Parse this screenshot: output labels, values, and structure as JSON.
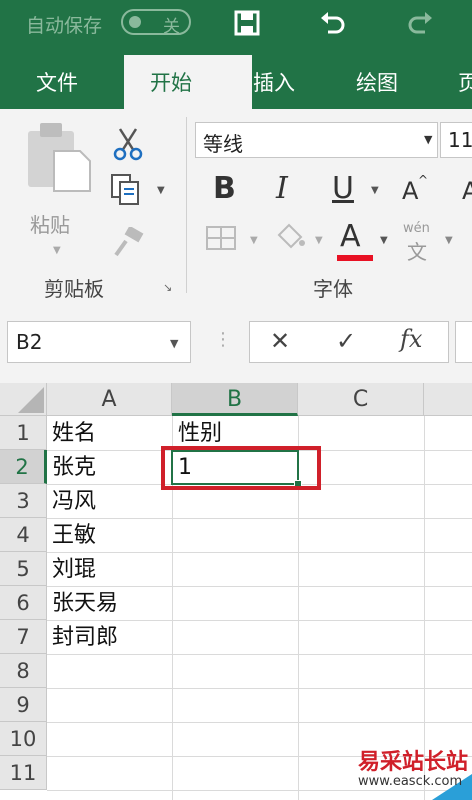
{
  "titlebar": {
    "autosave_label": "自动保存",
    "autosave_state": "关"
  },
  "tabs": [
    {
      "label": "文件"
    },
    {
      "label": "开始"
    },
    {
      "label": "插入"
    },
    {
      "label": "绘图"
    },
    {
      "label": "页"
    }
  ],
  "ribbon": {
    "paste_label": "粘贴",
    "clipboard_group": "剪贴板",
    "font_group": "字体",
    "font_name": "等线",
    "font_size": "11",
    "bold": "B",
    "italic": "I",
    "underline": "U",
    "grow_font": "A",
    "font_color": "A",
    "phonetic_top": "wén",
    "phonetic_bottom": "文",
    "font_color_hex": "#e81123"
  },
  "formula_bar": {
    "name_box": "B2",
    "cancel": "✕",
    "enter": "✓",
    "fx": "fx"
  },
  "sheet": {
    "columns": [
      "A",
      "B",
      "C"
    ],
    "rows": [
      "1",
      "2",
      "3",
      "4",
      "5",
      "6",
      "7",
      "8",
      "9",
      "10",
      "11"
    ],
    "cells": {
      "A1": "姓名",
      "B1": "性别",
      "A2": "张克",
      "B2": "1",
      "A3": "冯风",
      "A4": "王敏",
      "A5": "刘琨",
      "A6": "张天易",
      "A7": "封司郎"
    },
    "selected_cell": "B2"
  },
  "watermark": {
    "text": "易采站长站",
    "url": "www.easck.com"
  },
  "colors": {
    "accent": "#217346",
    "highlight": "#d0202a"
  }
}
